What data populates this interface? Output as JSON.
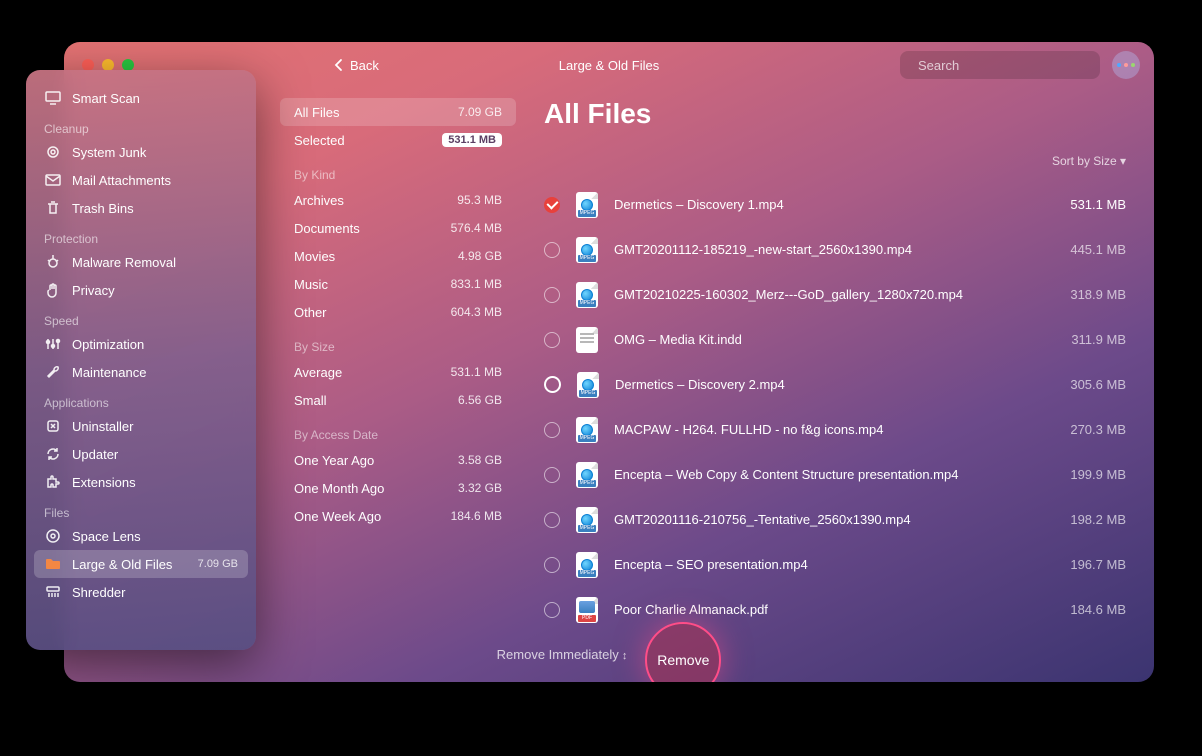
{
  "window": {
    "back_label": "Back",
    "title": "Large & Old Files",
    "search_placeholder": "Search"
  },
  "sidebar": {
    "smart_scan": "Smart Scan",
    "sections": {
      "cleanup": {
        "header": "Cleanup",
        "items": [
          "System Junk",
          "Mail Attachments",
          "Trash Bins"
        ]
      },
      "protection": {
        "header": "Protection",
        "items": [
          "Malware Removal",
          "Privacy"
        ]
      },
      "speed": {
        "header": "Speed",
        "items": [
          "Optimization",
          "Maintenance"
        ]
      },
      "applications": {
        "header": "Applications",
        "items": [
          "Uninstaller",
          "Updater",
          "Extensions"
        ]
      },
      "files": {
        "header": "Files",
        "items": [
          "Space Lens",
          "Large & Old Files",
          "Shredder"
        ],
        "large_old_size": "7.09 GB"
      }
    }
  },
  "filters": {
    "all_files": {
      "label": "All Files",
      "size": "7.09 GB"
    },
    "selected": {
      "label": "Selected",
      "size": "531.1 MB"
    },
    "by_kind": {
      "header": "By Kind",
      "items": [
        {
          "label": "Archives",
          "size": "95.3 MB"
        },
        {
          "label": "Documents",
          "size": "576.4 MB"
        },
        {
          "label": "Movies",
          "size": "4.98 GB"
        },
        {
          "label": "Music",
          "size": "833.1 MB"
        },
        {
          "label": "Other",
          "size": "604.3 MB"
        }
      ]
    },
    "by_size": {
      "header": "By Size",
      "items": [
        {
          "label": "Average",
          "size": "531.1 MB"
        },
        {
          "label": "Small",
          "size": "6.56 GB"
        }
      ]
    },
    "by_access": {
      "header": "By Access Date",
      "items": [
        {
          "label": "One Year Ago",
          "size": "3.58 GB"
        },
        {
          "label": "One Month Ago",
          "size": "3.32 GB"
        },
        {
          "label": "One Week Ago",
          "size": "184.6 MB"
        }
      ]
    }
  },
  "content": {
    "title": "All Files",
    "sort_label": "Sort by Size",
    "files": [
      {
        "name": "Dermetics – Discovery 1.mp4",
        "size": "531.1 MB",
        "type": "mp4",
        "checked": true
      },
      {
        "name": "GMT20201112-185219_-new-start_2560x1390.mp4",
        "size": "445.1 MB",
        "type": "mp4",
        "checked": false
      },
      {
        "name": "GMT20210225-160302_Merz---GoD_gallery_1280x720.mp4",
        "size": "318.9 MB",
        "type": "mp4",
        "checked": false
      },
      {
        "name": "OMG – Media Kit.indd",
        "size": "311.9 MB",
        "type": "doc",
        "checked": false
      },
      {
        "name": "Dermetics – Discovery 2.mp4",
        "size": "305.6 MB",
        "type": "mp4",
        "checked": false,
        "hover": true
      },
      {
        "name": "MACPAW - H264. FULLHD - no f&g icons.mp4",
        "size": "270.3 MB",
        "type": "mp4",
        "checked": false
      },
      {
        "name": "Encepta – Web Copy & Content Structure presentation.mp4",
        "size": "199.9 MB",
        "type": "mp4",
        "checked": false
      },
      {
        "name": "GMT20201116-210756_-Tentative_2560x1390.mp4",
        "size": "198.2 MB",
        "type": "mp4",
        "checked": false
      },
      {
        "name": "Encepta – SEO presentation.mp4",
        "size": "196.7 MB",
        "type": "mp4",
        "checked": false
      },
      {
        "name": "Poor Charlie Almanack.pdf",
        "size": "184.6 MB",
        "type": "pdf",
        "checked": false
      }
    ]
  },
  "footer": {
    "mode": "Remove Immediately",
    "action": "Remove"
  }
}
